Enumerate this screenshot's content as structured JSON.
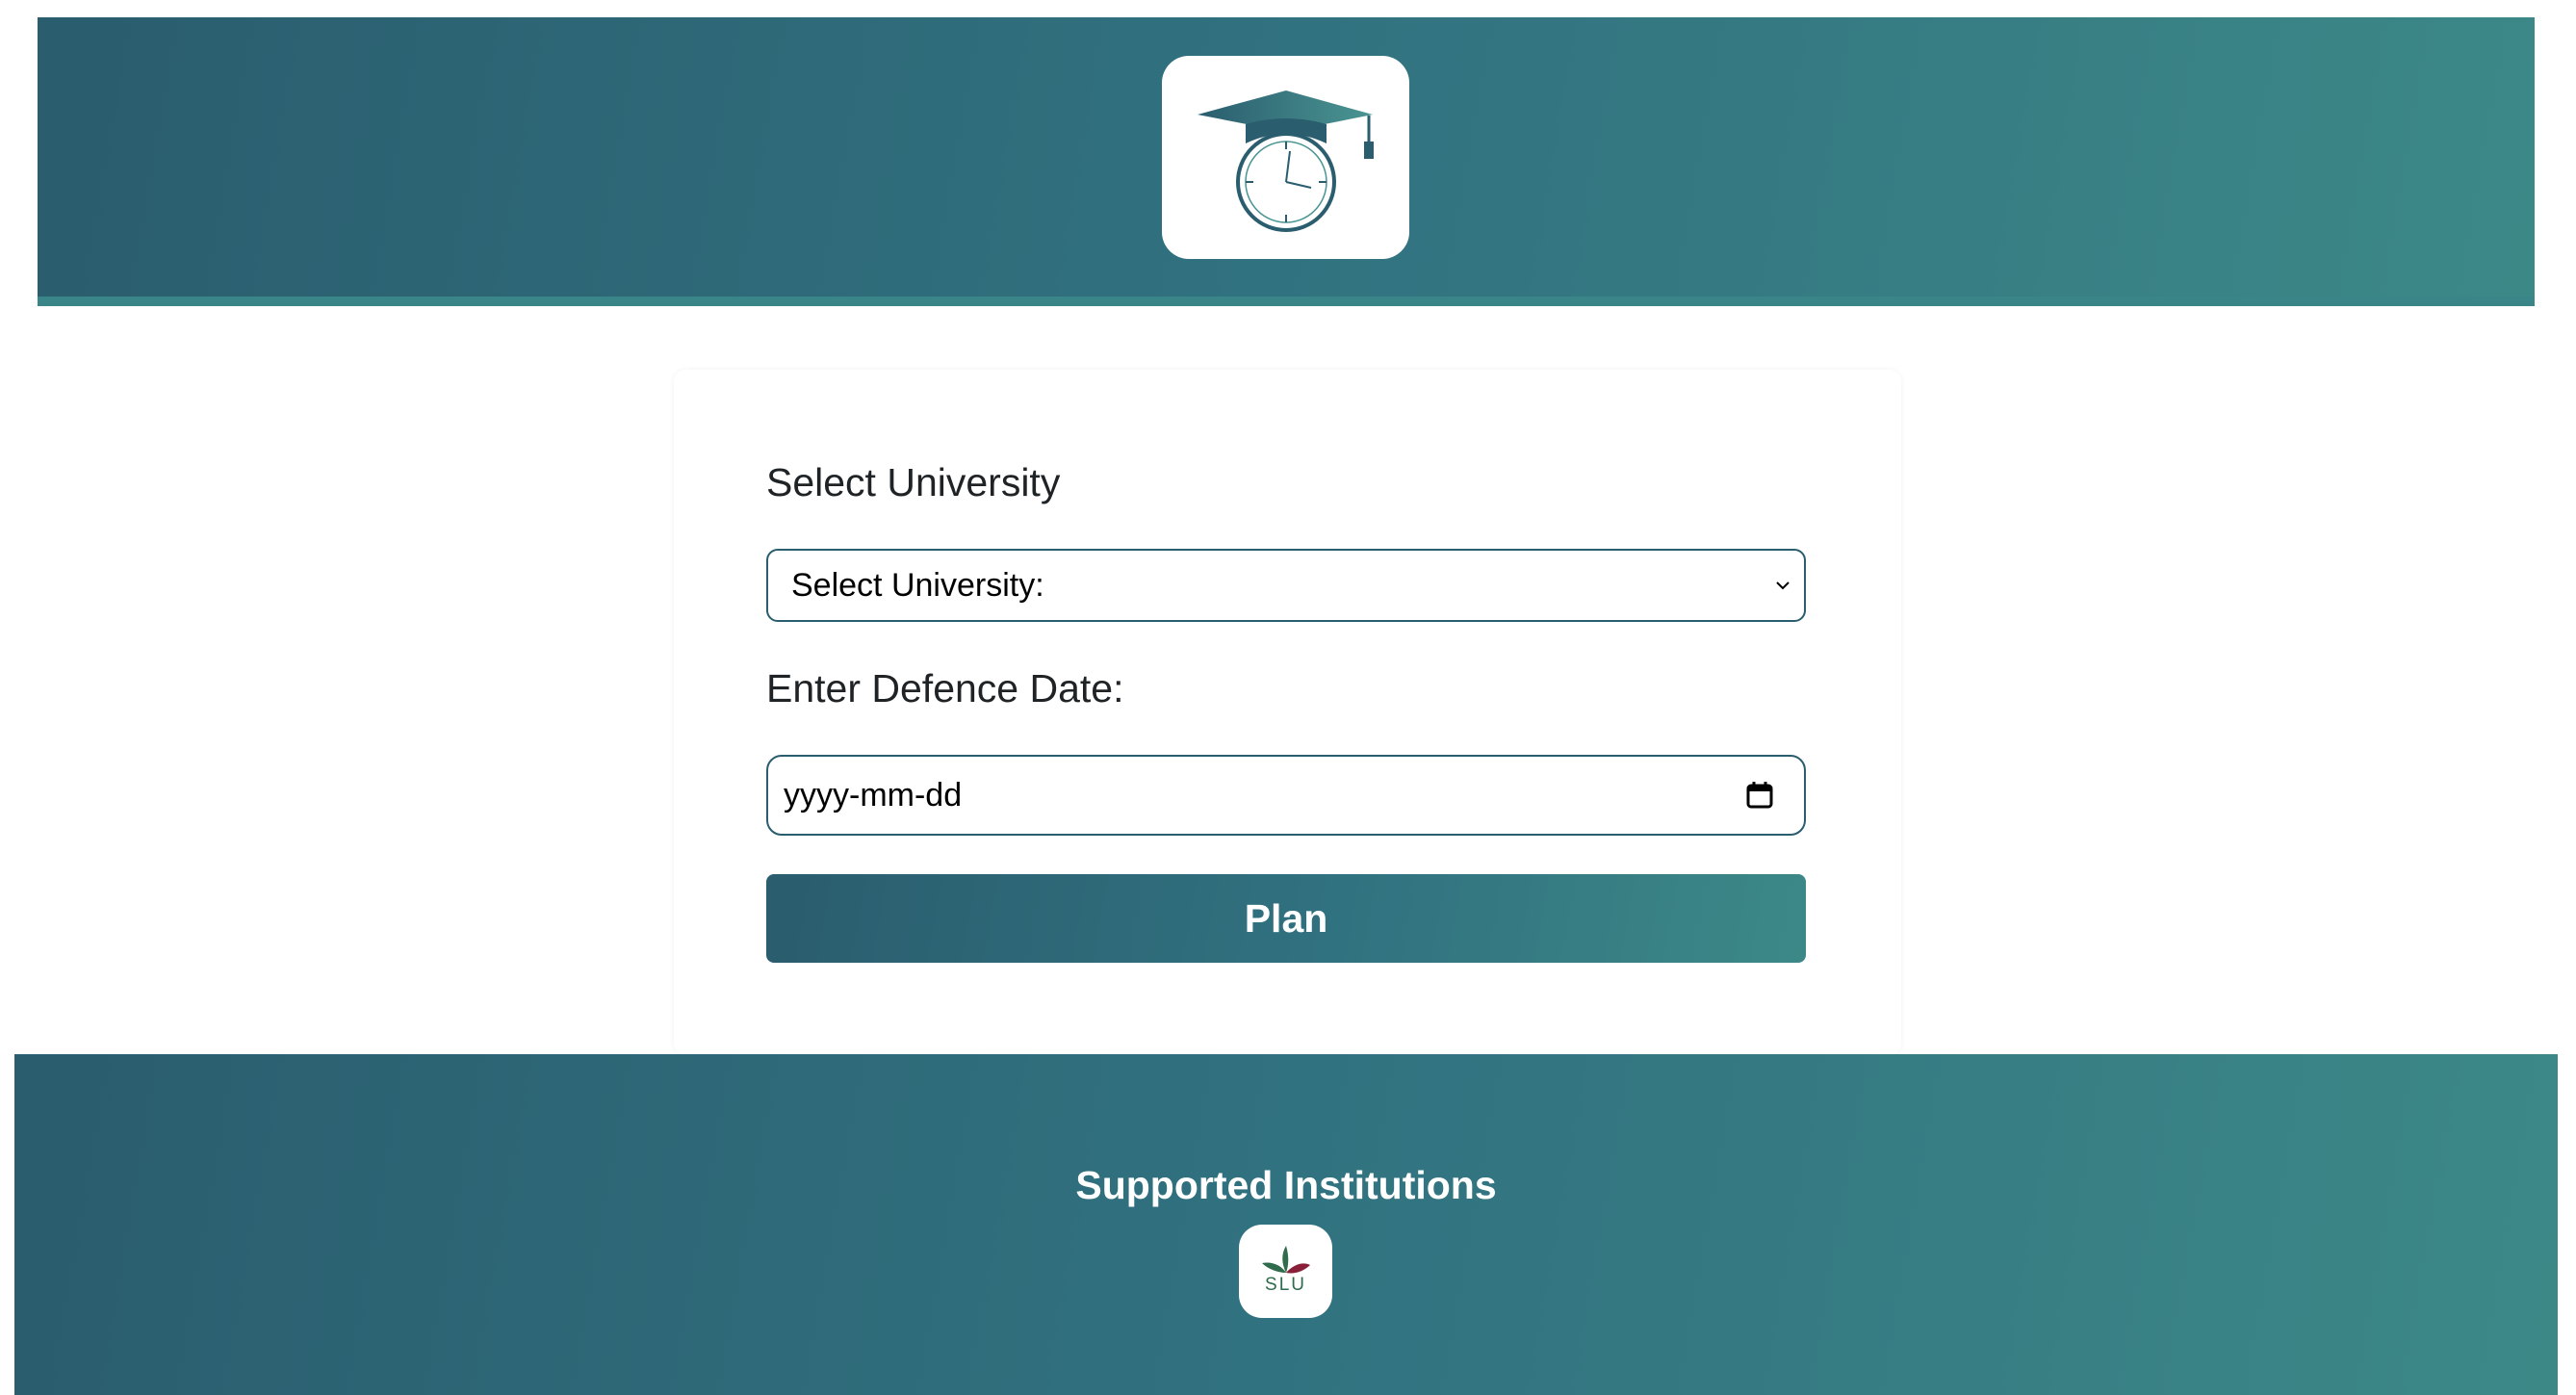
{
  "header": {
    "logo_icon": "graduation-cap-clock-icon"
  },
  "form": {
    "university_label": "Select University",
    "university_select_value": "Select University:",
    "date_label": "Enter Defence Date:",
    "date_placeholder": "yyyy-mm-dd",
    "plan_button_label": "Plan"
  },
  "footer": {
    "title": "Supported Institutions",
    "institutions": [
      {
        "name": "SLU",
        "icon": "slu-logo"
      }
    ]
  },
  "colors": {
    "primary_dark": "#2a5d6e",
    "primary_light": "#3c8887",
    "text": "#1f2326"
  }
}
